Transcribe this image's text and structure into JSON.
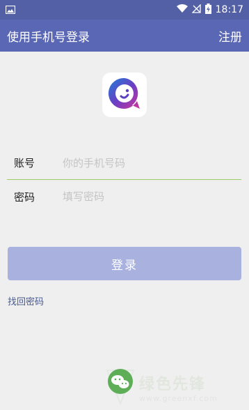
{
  "status_bar": {
    "time": "18:17",
    "icons": [
      "image-icon",
      "wifi-icon",
      "no-signal-icon",
      "battery-charging-icon"
    ]
  },
  "app_bar": {
    "title": "使用手机号登录",
    "register_label": "注册"
  },
  "logo": {
    "icon": "chat-bubble-logo-icon"
  },
  "form": {
    "account_label": "账号",
    "account_placeholder": "你的手机号码",
    "password_label": "密码",
    "password_placeholder": "填写密码"
  },
  "login_button_label": "登录",
  "forgot_password_label": "找回密码",
  "watermark": {
    "title": "绿色先锋",
    "url": "www.greenxf.com"
  },
  "colors": {
    "status_bar": "#5460a6",
    "app_bar": "#5a67b5",
    "login_button": "#a9b2df",
    "input_underline": "#9ccc65",
    "link": "#4a5a8e"
  }
}
